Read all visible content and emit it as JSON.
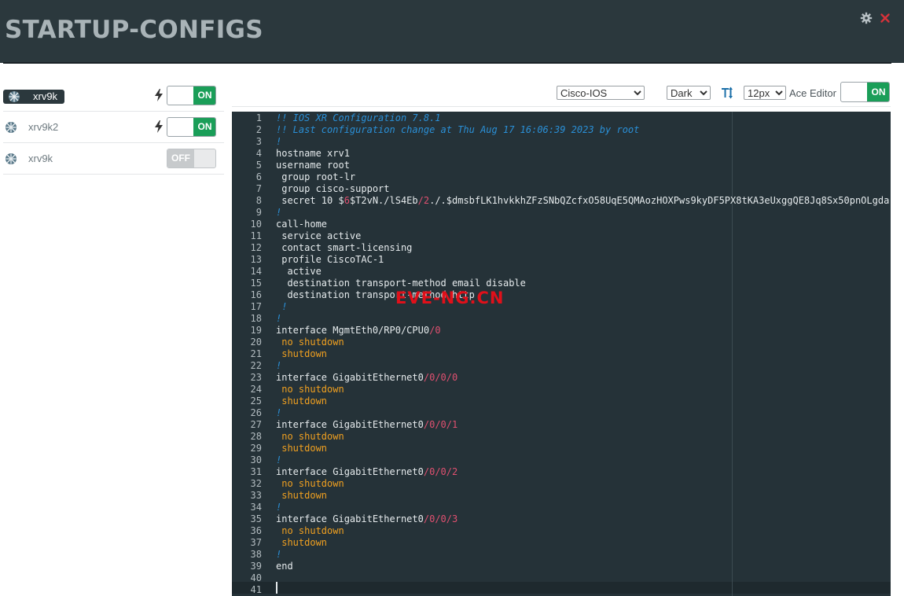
{
  "header": {
    "title": "STARTUP-CONFIGS"
  },
  "nodes": [
    {
      "name": "xrv9k",
      "has_bolt": true,
      "state": "ON",
      "active": true
    },
    {
      "name": "xrv9k2",
      "has_bolt": true,
      "state": "ON",
      "active": false
    },
    {
      "name": "xrv9k",
      "has_bolt": false,
      "state": "OFF",
      "active": false
    }
  ],
  "toolbar": {
    "platform": {
      "selected": "Cisco-IOS"
    },
    "theme": {
      "selected": "Dark"
    },
    "fontsize": {
      "selected": "12px"
    },
    "ace_label": "Ace Editor",
    "ace_toggle": "ON"
  },
  "editor": {
    "lines": [
      "!! IOS XR Configuration 7.8.1",
      "!! Last configuration change at Thu Aug 17 16:06:39 2023 by root",
      "!",
      "hostname xrv1",
      "username root",
      " group root-lr",
      " group cisco-support",
      " secret 10 $6$T2vN./lS4Eb/2./.$dmsbfLK1hvkkhZFzSNbQZcfxO58UqE5QMAozHOXPws9kyDF5PX8tKA3eUxggQE8Jq8Sx50pnOLgda",
      "!",
      "call-home",
      " service active",
      " contact smart-licensing",
      " profile CiscoTAC-1",
      "  active",
      "  destination transport-method email disable",
      "  destination transport-method http",
      " !",
      "!",
      "interface MgmtEth0/RP0/CPU0/0",
      " no shutdown",
      " shutdown",
      "!",
      "interface GigabitEthernet0/0/0/0",
      " no shutdown",
      " shutdown",
      "!",
      "interface GigabitEthernet0/0/0/1",
      " no shutdown",
      " shutdown",
      "!",
      "interface GigabitEthernet0/0/0/2",
      " no shutdown",
      " shutdown",
      "!",
      "interface GigabitEthernet0/0/0/3",
      " no shutdown",
      " shutdown",
      "!",
      "end",
      "",
      ""
    ]
  },
  "watermark": "EVE-NG.CN",
  "colors": {
    "header_bg": "#2b383d",
    "editor_bg": "#253238",
    "toggle_on": "#1a9e58",
    "comment": "#2a8fd6",
    "keyword": "#f0a020",
    "number": "#e05070"
  }
}
